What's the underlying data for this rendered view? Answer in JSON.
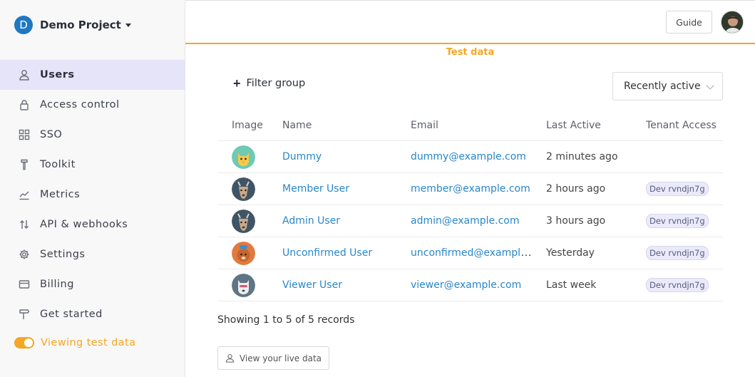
{
  "project": {
    "logo_letter": "D",
    "name": "Demo Project"
  },
  "nav": [
    {
      "label": "Users",
      "icon": "user-icon"
    },
    {
      "label": "Access control",
      "icon": "lock-icon"
    },
    {
      "label": "SSO",
      "icon": "grid-icon"
    },
    {
      "label": "Toolkit",
      "icon": "toolkit-icon"
    },
    {
      "label": "Metrics",
      "icon": "chart-icon"
    },
    {
      "label": "API & webhooks",
      "icon": "arrows-icon"
    },
    {
      "label": "Settings",
      "icon": "gear-icon"
    },
    {
      "label": "Billing",
      "icon": "card-icon"
    },
    {
      "label": "Get started",
      "icon": "signpost-icon"
    }
  ],
  "test_toggle": {
    "label": "Viewing test data",
    "on": true,
    "color": "#f5a623"
  },
  "header": {
    "guide_label": "Guide",
    "banner": "Test data"
  },
  "filter": {
    "label": "Filter group"
  },
  "sort": {
    "selected": "Recently active"
  },
  "table": {
    "columns": [
      "Image",
      "Name",
      "Email",
      "Last Active",
      "Tenant Access"
    ],
    "rows": [
      {
        "name": "Dummy",
        "email": "dummy@example.com",
        "last_active": "2 minutes ago",
        "tenant": "",
        "avatar": "cat-avatar"
      },
      {
        "name": "Member User",
        "email": "member@example.com",
        "last_active": "2 hours ago",
        "tenant": "Dev rvndjn7g",
        "avatar": "deer-avatar"
      },
      {
        "name": "Admin User",
        "email": "admin@example.com",
        "last_active": "3 hours ago",
        "tenant": "Dev rvndjn7g",
        "avatar": "deer-avatar"
      },
      {
        "name": "Unconfirmed User",
        "email": "unconfirmed@example.com",
        "last_active": "Yesterday",
        "tenant": "Dev rvndjn7g",
        "avatar": "bear-avatar"
      },
      {
        "name": "Viewer User",
        "email": "viewer@example.com",
        "last_active": "Last week",
        "tenant": "Dev rvndjn7g",
        "avatar": "dog-avatar"
      }
    ]
  },
  "records_text": "Showing 1 to 5 of 5 records",
  "live_button": {
    "label": "View your live data"
  },
  "colors": {
    "accent": "#f5a623",
    "link": "#2a86c8",
    "active_nav": "#e5e4f8"
  }
}
